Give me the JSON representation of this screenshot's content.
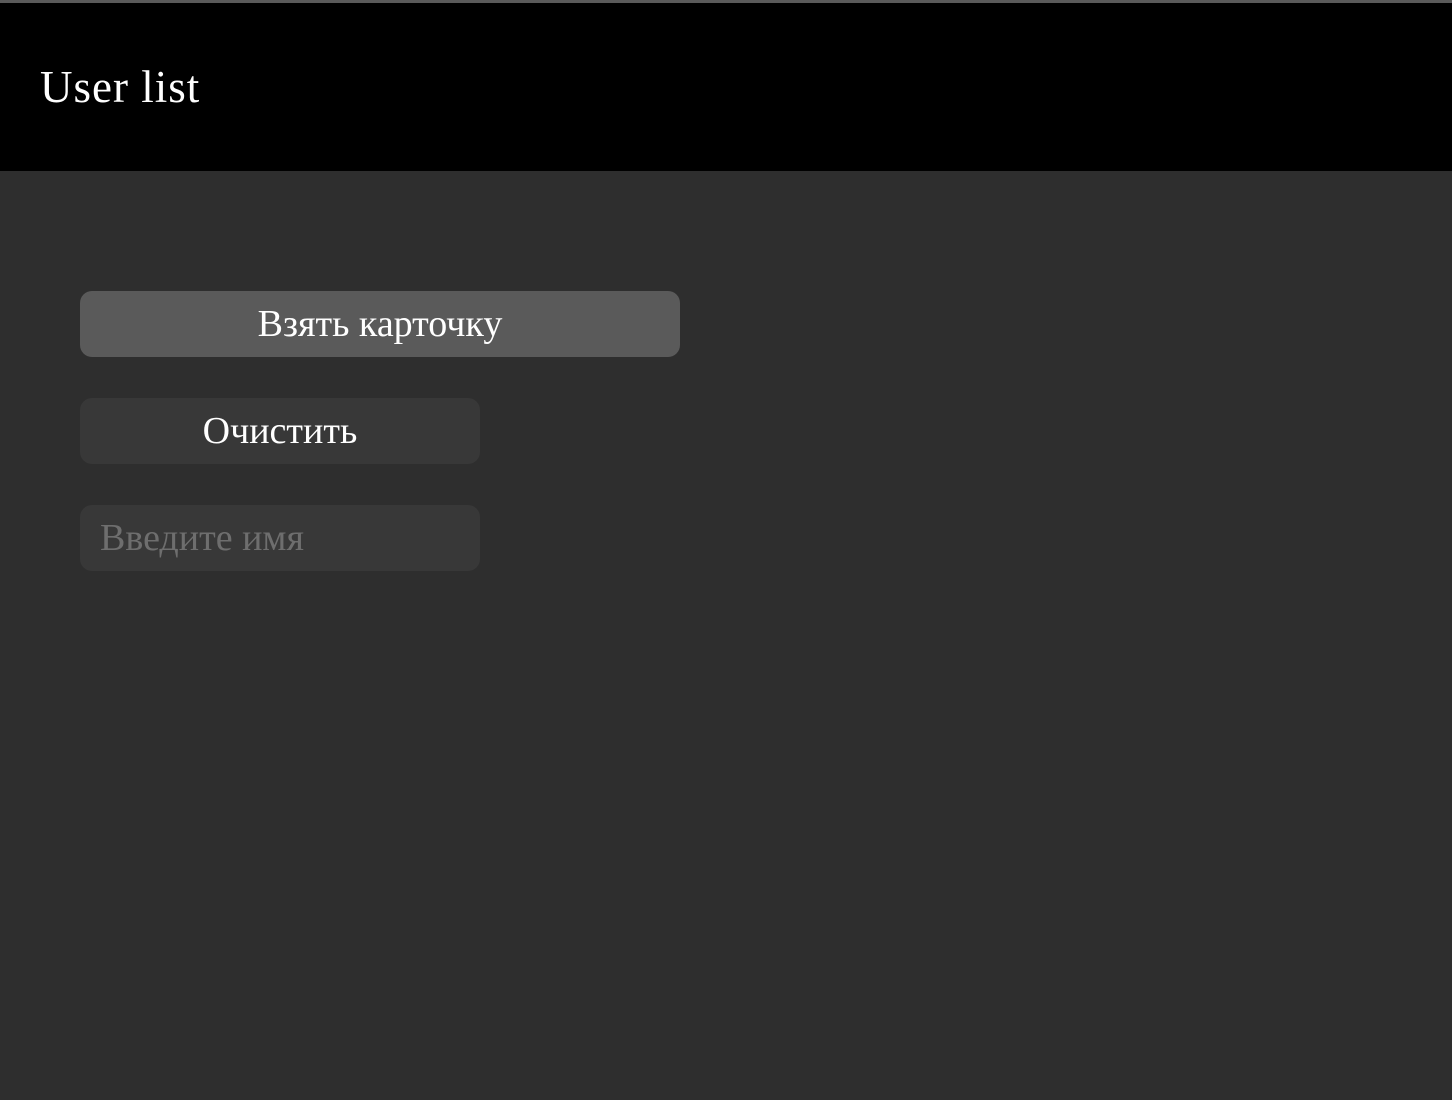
{
  "header": {
    "title": "User list",
    "background": "#000000",
    "text_color": "#ffffff"
  },
  "main": {
    "background": "#2e2e2e",
    "take_card_button": {
      "label": "Взять карточку",
      "background": "#5a5a5a"
    },
    "clear_button": {
      "label": "Очистить",
      "background": "#383838"
    },
    "name_input": {
      "value": "",
      "placeholder": "Введите имя",
      "background": "#383838"
    }
  }
}
